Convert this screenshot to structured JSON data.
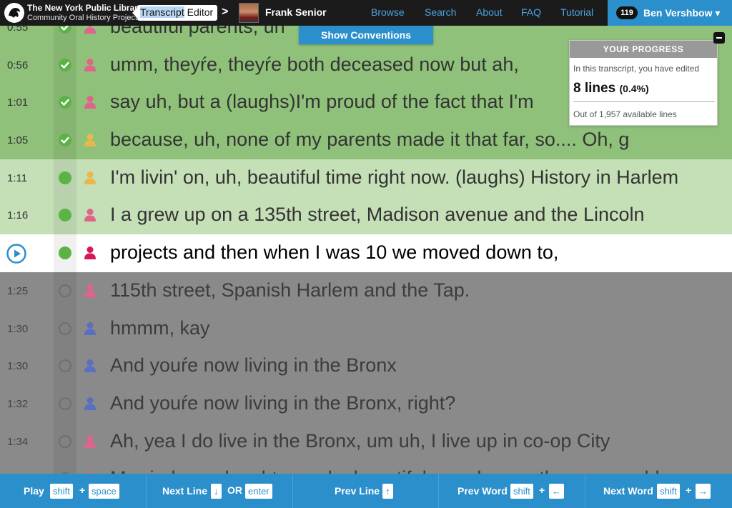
{
  "header": {
    "library_name": "The New York Public Library",
    "project_name": "Community Oral History Project",
    "crumb_highlight": "Transcript",
    "crumb_rest": " Editor",
    "crumb_arrow": ">",
    "narrator_name": "Frank Senior",
    "nav": [
      "Browse",
      "Search",
      "About",
      "FAQ",
      "Tutorial"
    ],
    "user_count": "119",
    "user_name": "Ben Vershbow ▾"
  },
  "show_conventions": "Show Conventions",
  "progress": {
    "heading": "YOUR PROGRESS",
    "description": "In this transcript, you have edited",
    "lines_edited": "8 lines",
    "percent": "(0.4%)",
    "available": "Out of 1,957 available lines"
  },
  "lines": [
    {
      "time": "0:55",
      "status": "done",
      "speaker": "pink",
      "text": "beautiful parents, uh"
    },
    {
      "time": "0:56",
      "status": "done",
      "speaker": "pink",
      "text": "umm, theyŕe, theyŕe both deceased now but ah,"
    },
    {
      "time": "1:01",
      "status": "done",
      "speaker": "pink",
      "text": "say uh, but a (laughs)I'm proud of the fact that I'm"
    },
    {
      "time": "1:05",
      "status": "done",
      "speaker": "yellow",
      "text": "because, uh, none of my parents made it that far, so.... Oh, g"
    },
    {
      "time": "1:11",
      "status": "edited",
      "speaker": "yellow",
      "text": "I'm livin' on, uh,  beautiful time right now. (laughs) History in Harlem"
    },
    {
      "time": "1:16",
      "status": "edited",
      "speaker": "pink",
      "text": "I a grew up on a 135th street, Madison avenue and the Lincoln"
    },
    {
      "time": "",
      "status": "active",
      "speaker": "magenta",
      "text": "projects and then when I was 10 we moved down to,"
    },
    {
      "time": "1:25",
      "status": "pending",
      "speaker": "pink",
      "text": "115th street, Spanish Harlem and the Tap."
    },
    {
      "time": "1:30",
      "status": "pending",
      "speaker": "blue",
      "text": "hmmm, kay"
    },
    {
      "time": "1:30",
      "status": "pending",
      "speaker": "blue",
      "text": "And youŕe now living in the Bronx"
    },
    {
      "time": "1:32",
      "status": "pending",
      "speaker": "blue",
      "text": "And youŕe now living in the Bronx, right?"
    },
    {
      "time": "1:34",
      "status": "pending",
      "speaker": "pink",
      "text": "Ah, yea I do live in the Bronx, um uh, I live up in co-op City"
    },
    {
      "time": "",
      "status": "pending",
      "speaker": "pink",
      "text": "Married one daughter and a beautiful grandson, a three-year-old"
    }
  ],
  "footer": {
    "play": {
      "label": "Play",
      "key1": "shift",
      "sep": "+",
      "key2": "space"
    },
    "next_line": {
      "label": "Next Line",
      "key1": "↓",
      "sep": "OR",
      "key2": "enter"
    },
    "prev_line": {
      "label": "Prev Line",
      "key1": "↑"
    },
    "prev_word": {
      "label": "Prev Word",
      "key1": "shift",
      "sep": "+",
      "key2": "←"
    },
    "next_word": {
      "label": "Next Word",
      "key1": "shift",
      "sep": "+",
      "key2": "→"
    }
  },
  "colors": {
    "accent_blue": "#2b8fcc",
    "done_green": "#8fc17a",
    "edited_green": "#c5dfb7",
    "status_green": "#5cb345",
    "speaker_pink": "#e0638a",
    "speaker_yellow": "#e9b84a",
    "speaker_blue": "#5a6fc0",
    "speaker_magenta": "#d6185a"
  }
}
